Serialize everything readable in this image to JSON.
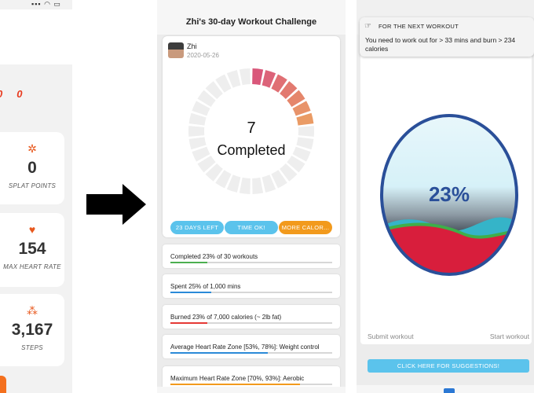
{
  "left_panel": {
    "zeros": [
      "0",
      "0"
    ],
    "stats": [
      {
        "value": "0",
        "label": "SPLAT POINTS",
        "icon": "splat-icon"
      },
      {
        "value": "154",
        "label": "MAX HEART RATE",
        "icon": "heart-icon"
      },
      {
        "value": "3,167",
        "label": "STEPS",
        "icon": "footsteps-icon"
      }
    ]
  },
  "middle": {
    "title": "Zhi's 30-day Workout Challenge",
    "user": {
      "name": "Zhi",
      "date": "2020-05-26"
    },
    "progress": {
      "completed": "7",
      "label": "Completed",
      "total_segments": 30,
      "completed_fraction": 0.233
    },
    "pills": [
      {
        "label": "23 DAYS LEFT",
        "color": "#5bc3ec"
      },
      {
        "label": "TIME OK!",
        "color": "#5bc3ec"
      },
      {
        "label": "MORE CALOR...",
        "color": "#f29a1d"
      }
    ],
    "bars": [
      {
        "text": "Completed 23% of 30 workouts",
        "fraction": 0.23,
        "color": "#4caf50"
      },
      {
        "text": "Spent 25% of 1,000 mins",
        "fraction": 0.25,
        "color": "#2b8ad8"
      },
      {
        "text": "Burned 23% of 7,000 calories (~ 2lb fat)",
        "fraction": 0.23,
        "color": "#e53935"
      },
      {
        "text": "Average Heart Rate Zone [53%, 78%]: Weight control",
        "fraction": 0.6,
        "color": "#2b8ad8"
      },
      {
        "text": "Maximum Heart Rate Zone [70%, 93%]: Aerobic",
        "fraction": 0.8,
        "color": "#f29a1d"
      }
    ]
  },
  "right": {
    "notice_title": "FOR THE NEXT WORKOUT",
    "notice_body": "You need to work out for > 33 mins and burn > 234 calories",
    "percent": "23%",
    "submit_label": "Submit workout",
    "start_label": "Start workout",
    "suggestions_label": "CLICK HERE FOR SUGGESTIONS!"
  }
}
